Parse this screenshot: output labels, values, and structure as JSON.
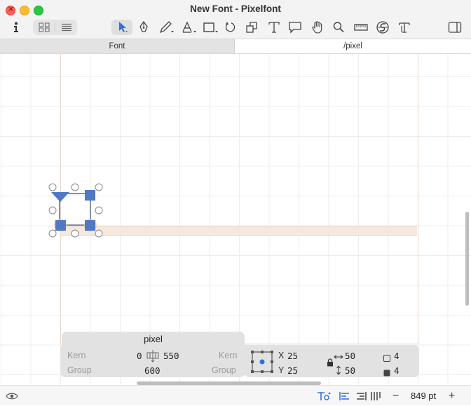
{
  "window": {
    "title": "New Font - Pixelfont"
  },
  "toolbar": {
    "info": "info-icon",
    "view_grid": "grid-view-icon",
    "view_list": "list-view-icon",
    "tools": [
      "select-tool-icon",
      "pen-tool-icon",
      "pencil-tool-icon",
      "component-tool-icon",
      "rectangle-tool-icon",
      "rotate-tool-icon",
      "scale-tool-icon",
      "text-tool-icon",
      "annotation-tool-icon",
      "hand-tool-icon",
      "zoom-tool-icon",
      "measure-tool-icon",
      "spline-tool-icon",
      "type-tool-icon",
      "sidebar-icon"
    ]
  },
  "tabs": {
    "font": "Font",
    "glyph": "/pixel"
  },
  "panel": {
    "glyph_name": "pixel",
    "kern_left_label": "Kern",
    "kern_left_value": "0",
    "width_value": "550",
    "kern_right_label": "Kern",
    "group_left_label": "Group",
    "group_value": "600",
    "group_right_label": "Group",
    "x_label": "X",
    "x_value": "25",
    "y_label": "Y",
    "y_value": "25",
    "w_value": "50",
    "h_value": "50",
    "count_a": "4",
    "count_b": "4"
  },
  "status": {
    "zoom_value": "849 pt",
    "zoom_minus": "−",
    "zoom_plus": "+"
  },
  "colors": {
    "accent": "#2f6fe0",
    "node": "#4f79c5",
    "selection": "#ead8c9"
  }
}
